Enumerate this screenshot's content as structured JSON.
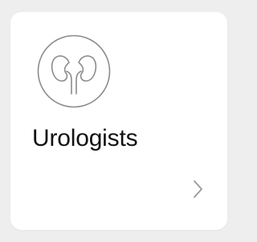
{
  "card": {
    "title": "Urologists",
    "icon": "kidneys-icon",
    "action_icon": "chevron-right-icon"
  },
  "colors": {
    "background": "#eeeeee",
    "card": "#ffffff",
    "title": "#111111",
    "icon_stroke": "#8c8c8c",
    "chevron": "#9a9a9a"
  }
}
